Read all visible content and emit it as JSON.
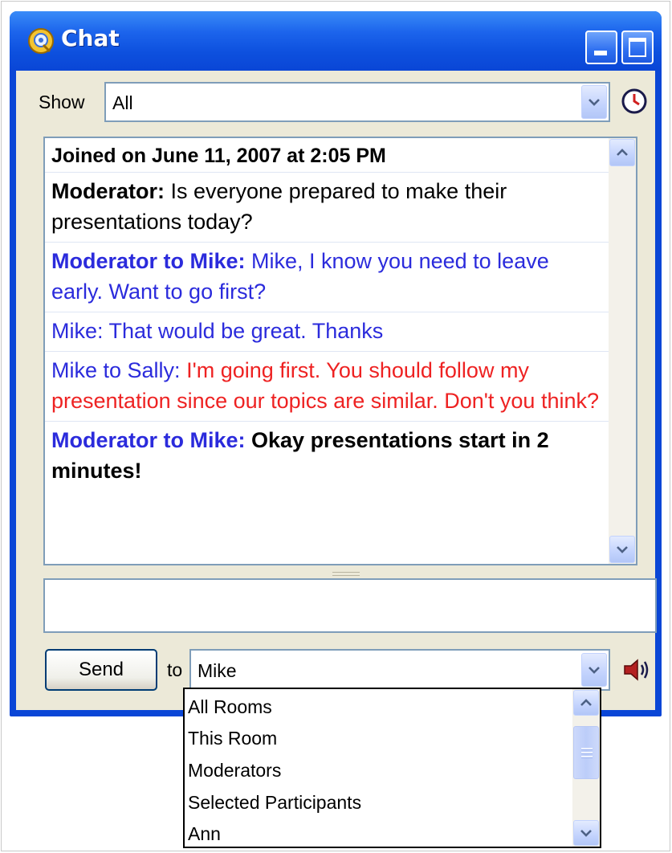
{
  "window": {
    "title": "Chat",
    "accent_color": "#0a46d6",
    "titlebar_buttons": [
      "minimize-icon",
      "maximize-icon"
    ]
  },
  "show": {
    "label": "Show",
    "value": "All",
    "history_icon": "clock-icon"
  },
  "chat": {
    "joined": "Joined on June 11, 2007 at 2:05 PM",
    "messages": [
      {
        "sender": "Moderator:",
        "text": " Is everyone prepared to make their presentations today?"
      },
      {
        "sender": "Moderator to Mike:",
        "text": " Mike, I know you need to leave early.  Want to go first?"
      },
      {
        "sender": "Mike: ",
        "text": "That would be great.  Thanks"
      },
      {
        "sender": "Mike to Sally: ",
        "text": "I'm going first.  You should follow my presentation since our topics are similar.  Don't you think?"
      },
      {
        "sender": "Moderator to Mike:",
        "text": " Okay presentations start in 2 minutes!"
      }
    ],
    "colors": {
      "blue": "#2b2bdc",
      "red": "#ee2222"
    }
  },
  "compose": {
    "value": ""
  },
  "send": {
    "button_label": "Send",
    "to_label": "to",
    "to_value": "Mike",
    "audio_icon": "speaker-icon"
  },
  "dropdown": {
    "options": [
      "All Rooms",
      "This Room",
      "Moderators",
      "Selected Participants",
      "Ann"
    ]
  }
}
